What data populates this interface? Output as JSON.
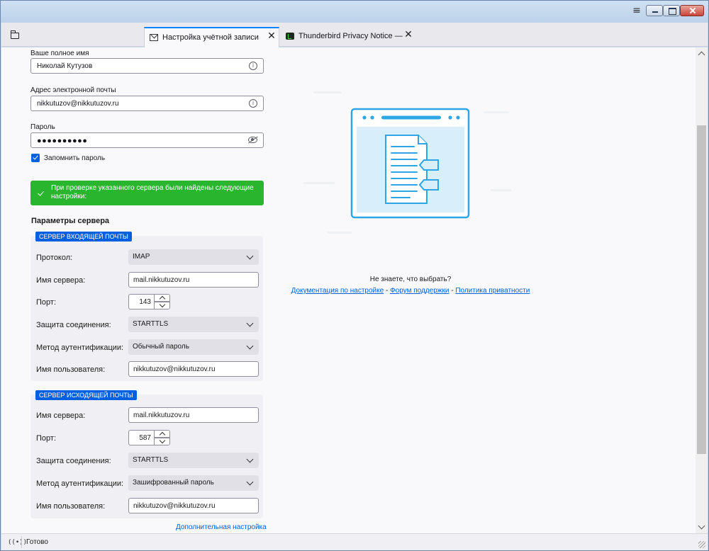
{
  "window": {
    "menu_glyph": "≡",
    "minimize_icon": "minimize-icon",
    "maximize_icon": "maximize-icon",
    "close_icon": "close-icon"
  },
  "tabs": [
    {
      "title": "Настройка учётной записи",
      "icon": "mail-icon",
      "close": "✕",
      "active": true
    },
    {
      "title": "Thunderbird Privacy Notice — Mozilla",
      "icon": "thunderbird-icon",
      "close": "✕",
      "active": false
    }
  ],
  "account": {
    "name_label": "Ваше полное имя",
    "name_value": "Николай Кутузов",
    "email_label": "Адрес электронной почты",
    "email_value": "nikkutuzov@nikkutuzov.ru",
    "password_label": "Пароль",
    "password_value": "●●●●●●●●●●",
    "remember_label": "Запомнить пароль",
    "remember_checked": true,
    "info_glyph": "i"
  },
  "notice": {
    "text": "При проверке указанного сервера были найдены следующие настройки:",
    "color": "#29b52e"
  },
  "server": {
    "section_title": "Параметры сервера",
    "incoming": {
      "badge": "Сервер входящей почты",
      "protocol_label": "Протокол:",
      "protocol_value": "IMAP",
      "hostname_label": "Имя сервера:",
      "hostname_value": "mail.nikkutuzov.ru",
      "port_label": "Порт:",
      "port_value": "143",
      "security_label": "Защита соединения:",
      "security_value": "STARTTLS",
      "auth_label": "Метод аутентификации:",
      "auth_value": "Обычный пароль",
      "username_label": "Имя пользователя:",
      "username_value": "nikkutuzov@nikkutuzov.ru"
    },
    "outgoing": {
      "badge": "Сервер исходящей почты",
      "hostname_label": "Имя сервера:",
      "hostname_value": "mail.nikkutuzov.ru",
      "port_label": "Порт:",
      "port_value": "587",
      "security_label": "Защита соединения:",
      "security_value": "STARTTLS",
      "auth_label": "Метод аутентификации:",
      "auth_value": "Зашифрованный пароль",
      "username_label": "Имя пользователя:",
      "username_value": "nikkutuzov@nikkutuzov.ru"
    },
    "advanced_link": "Дополнительная настройка"
  },
  "help": {
    "question": "Не знаете, что выбрать?",
    "docs_link": "Документация по настройке",
    "forum_link": "Форум поддержки",
    "privacy_link": "Политика приватности",
    "separator": " - "
  },
  "status": {
    "text": "Готово",
    "icon_glyph": "((•))"
  },
  "colors": {
    "accent": "#0060df",
    "tab_highlight": "#0a84ff",
    "illustration": "#2ea6e6"
  }
}
